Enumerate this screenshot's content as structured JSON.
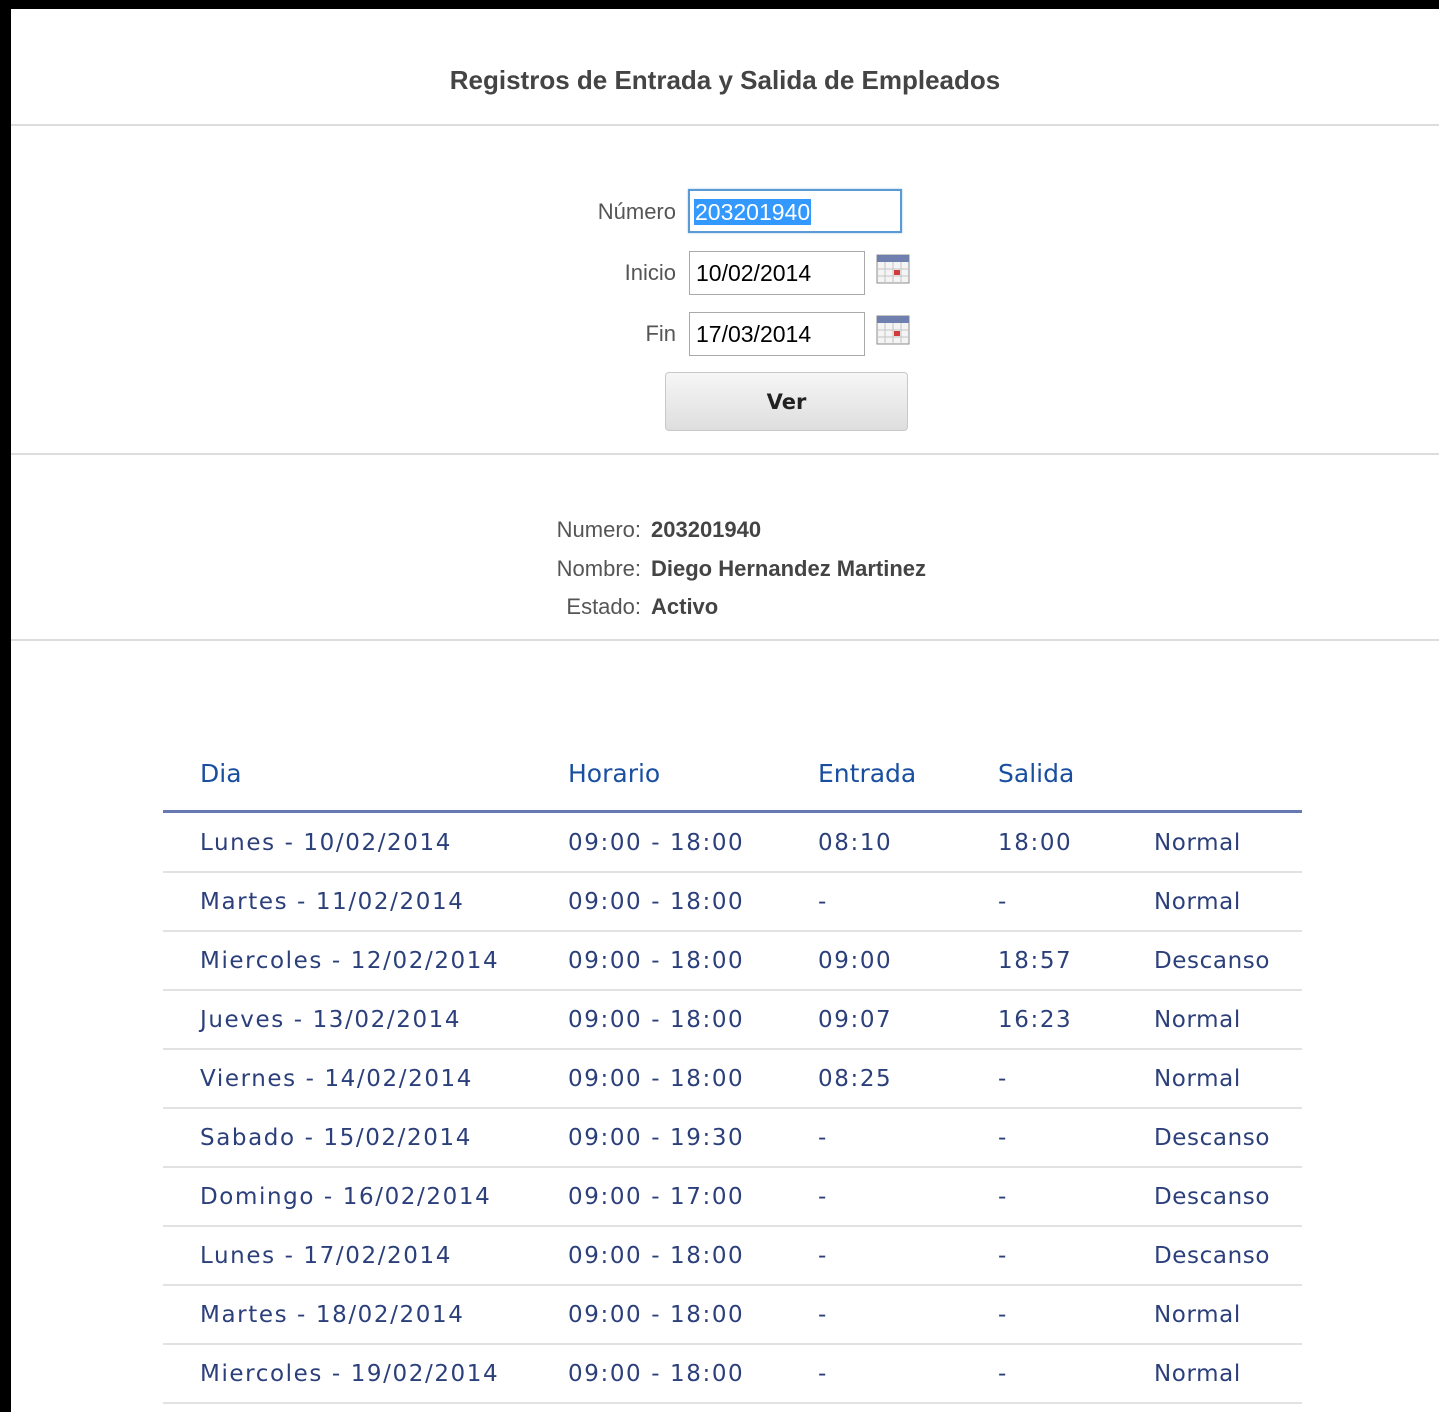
{
  "page": {
    "title": "Registros de Entrada y Salida de Empleados"
  },
  "form": {
    "numero_label": "Número",
    "numero_value": "203201940",
    "inicio_label": "Inicio",
    "inicio_value": "10/02/2014",
    "fin_label": "Fin",
    "fin_value": "17/03/2014",
    "calendar_icon": "calendar-icon",
    "submit_label": "Ver"
  },
  "employee": {
    "numero_label": "Numero:",
    "numero_value": "203201940",
    "nombre_label": "Nombre:",
    "nombre_value": "Diego Hernandez Martinez",
    "estado_label": "Estado:",
    "estado_value": "Activo"
  },
  "table": {
    "headers": [
      "Dia",
      "Horario",
      "Entrada",
      "Salida"
    ],
    "rows": [
      {
        "dia": "Lunes - 10/02/2014",
        "horario": "09:00 - 18:00",
        "entrada": "08:10",
        "salida": "18:00",
        "tipo": "Normal"
      },
      {
        "dia": "Martes - 11/02/2014",
        "horario": "09:00 - 18:00",
        "entrada": "-",
        "salida": "-",
        "tipo": "Normal"
      },
      {
        "dia": "Miercoles - 12/02/2014",
        "horario": "09:00 - 18:00",
        "entrada": "09:00",
        "salida": "18:57",
        "tipo": "Descanso"
      },
      {
        "dia": "Jueves - 13/02/2014",
        "horario": "09:00 - 18:00",
        "entrada": "09:07",
        "salida": "16:23",
        "tipo": "Normal"
      },
      {
        "dia": "Viernes - 14/02/2014",
        "horario": "09:00 - 18:00",
        "entrada": "08:25",
        "salida": "-",
        "tipo": "Normal"
      },
      {
        "dia": "Sabado - 15/02/2014",
        "horario": "09:00 - 19:30",
        "entrada": "-",
        "salida": "-",
        "tipo": "Descanso"
      },
      {
        "dia": "Domingo - 16/02/2014",
        "horario": "09:00 - 17:00",
        "entrada": "-",
        "salida": "-",
        "tipo": "Descanso"
      },
      {
        "dia": "Lunes - 17/02/2014",
        "horario": "09:00 - 18:00",
        "entrada": "-",
        "salida": "-",
        "tipo": "Descanso"
      },
      {
        "dia": "Martes - 18/02/2014",
        "horario": "09:00 - 18:00",
        "entrada": "-",
        "salida": "-",
        "tipo": "Normal"
      },
      {
        "dia": "Miercoles - 19/02/2014",
        "horario": "09:00 - 18:00",
        "entrada": "-",
        "salida": "-",
        "tipo": "Normal"
      }
    ]
  },
  "colors": {
    "frame": "#000000",
    "table_text": "#2b3f7a",
    "header_text": "#1a4fa0",
    "header_rule": "#6779b1",
    "focus_border": "#5b9bd5",
    "selection": "#3399ff"
  }
}
